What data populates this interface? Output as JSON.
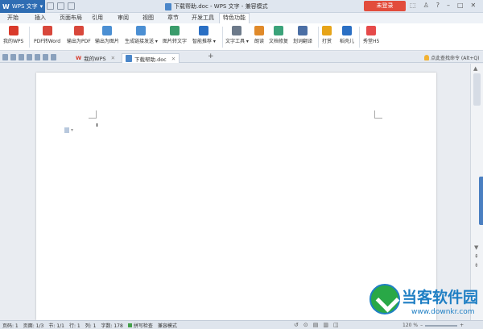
{
  "window": {
    "app_label": "WPS 文字",
    "doc_title": "下载帮助.doc - WPS 文字 - 兼容模式",
    "login_label": "未登录",
    "controls": [
      "⬚",
      "♙",
      "?",
      "–",
      "□",
      "✕"
    ]
  },
  "menu": {
    "tabs": [
      "开始",
      "插入",
      "页面布局",
      "引用",
      "审阅",
      "视图",
      "章节",
      "开发工具",
      "特色功能"
    ],
    "active": "特色功能"
  },
  "ribbon": {
    "buttons": [
      {
        "label": "我的WPS",
        "icon": "wps-logo-icon",
        "color": "#d93a2b"
      },
      {
        "label": "PDF转Word",
        "icon": "pdf-to-word-icon",
        "color": "#d8473b"
      },
      {
        "label": "输出为PDF",
        "icon": "export-pdf-icon",
        "color": "#d8473b"
      },
      {
        "label": "输出为图片",
        "icon": "export-image-icon",
        "color": "#4b8fd3"
      },
      {
        "label": "生成链接发送 ▾",
        "icon": "share-link-icon",
        "color": "#4b8fd3"
      },
      {
        "label": "图片转文字",
        "icon": "image-to-text-icon",
        "color": "#3a9c6b"
      },
      {
        "label": "智能推荐 ▾",
        "icon": "smart-recommend-icon",
        "color": "#2a6fc4"
      },
      {
        "label": "文字工具 ▾",
        "icon": "text-tools-icon",
        "color": "#6d7a8a"
      },
      {
        "label": "朗读",
        "icon": "read-aloud-icon",
        "color": "#e08a2a"
      },
      {
        "label": "文档修复",
        "icon": "doc-repair-icon",
        "color": "#3ba37a"
      },
      {
        "label": "划词翻译",
        "icon": "translate-icon",
        "color": "#4b6fa5"
      },
      {
        "label": "打赏",
        "icon": "reward-icon",
        "color": "#e7a418"
      },
      {
        "label": "稻壳儿",
        "icon": "docer-icon",
        "color": "#2a6fc4"
      },
      {
        "label": "秀堂H5",
        "icon": "h5-icon",
        "color": "#e64a4a"
      }
    ]
  },
  "doc_tabs": {
    "tabs": [
      {
        "label": "我的WPS",
        "active": false
      },
      {
        "label": "下载帮助.doc",
        "active": true
      }
    ],
    "add_label": "+",
    "cmd_search": "点此查找命令 (Alt+Q)"
  },
  "status": {
    "items": [
      "页码: 1",
      "页面: 1/3",
      "节: 1/1",
      "行: 1",
      "列: 1",
      "字数: 178"
    ],
    "spell": "拼写检查",
    "mode": "兼容模式",
    "zoom": "120 %"
  },
  "watermark": {
    "title": "当客软件园",
    "url": "www.downkr.com"
  }
}
